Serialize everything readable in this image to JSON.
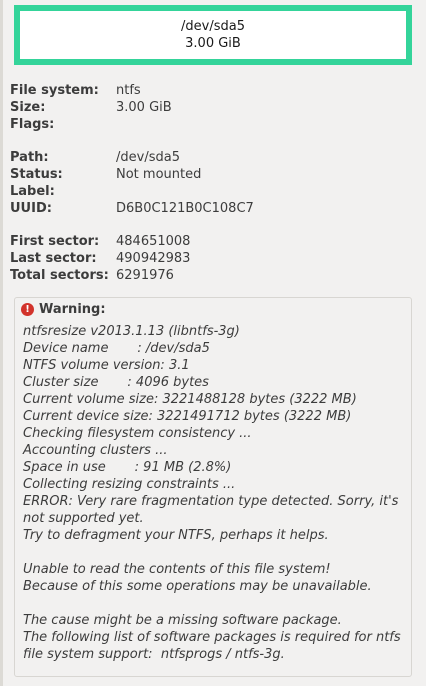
{
  "partition": {
    "path": "/dev/sda5",
    "size": "3.00 GiB"
  },
  "properties": {
    "group1": [
      {
        "label": "File system:",
        "value": "ntfs"
      },
      {
        "label": "Size:",
        "value": "3.00 GiB"
      },
      {
        "label": "Flags:",
        "value": ""
      }
    ],
    "group2": [
      {
        "label": "Path:",
        "value": "/dev/sda5"
      },
      {
        "label": "Status:",
        "value": "Not mounted"
      },
      {
        "label": "Label:",
        "value": ""
      },
      {
        "label": "UUID:",
        "value": "D6B0C121B0C108C7"
      }
    ],
    "group3": [
      {
        "label": "First sector:",
        "value": "484651008"
      },
      {
        "label": "Last sector:",
        "value": "490942983"
      },
      {
        "label": "Total sectors:",
        "value": "6291976"
      }
    ]
  },
  "warning": {
    "title": "Warning:",
    "icon": "error-icon",
    "icon_color": "#d2332b",
    "lines": [
      "ntfsresize v2013.1.13 (libntfs-3g)",
      "Device name       : /dev/sda5",
      "NTFS volume version: 3.1",
      "Cluster size       : 4096 bytes",
      "Current volume size: 3221488128 bytes (3222 MB)",
      "Current device size: 3221491712 bytes (3222 MB)",
      "Checking filesystem consistency ...",
      "Accounting clusters ...",
      "Space in use       : 91 MB (2.8%)",
      "Collecting resizing constraints ...",
      "ERROR: Very rare fragmentation type detected. Sorry, it's",
      "not supported yet.",
      "Try to defragment your NTFS, perhaps it helps.",
      "",
      "Unable to read the contents of this file system!",
      "Because of this some operations may be unavailable.",
      "",
      "The cause might be a missing software package.",
      "The following list of software packages is required for ntfs",
      "file system support:  ntfsprogs / ntfs-3g."
    ]
  },
  "colors": {
    "partition_border": "#34d49a",
    "background": "#f2f1f0"
  }
}
